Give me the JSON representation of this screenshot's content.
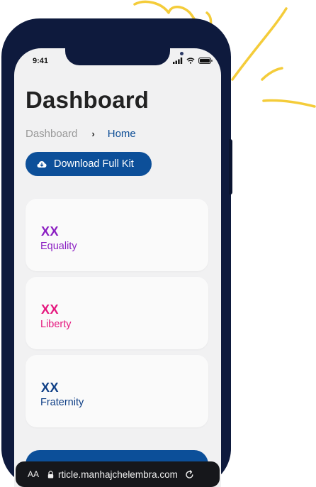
{
  "statusbar": {
    "time": "9:41"
  },
  "page": {
    "title": "Dashboard"
  },
  "breadcrumb": {
    "parent": "Dashboard",
    "separator": "›",
    "current": "Home"
  },
  "download_button": {
    "label": "Download Full Kit",
    "icon": "cloud-download-icon"
  },
  "cards": [
    {
      "code": "XX",
      "label": "Equality",
      "color": "#8b1fc2"
    },
    {
      "code": "XX",
      "label": "Liberty",
      "color": "#e5177e"
    },
    {
      "code": "XX",
      "label": "Fraternity",
      "color": "#0f3f86"
    }
  ],
  "browser": {
    "aa_label": "AA",
    "url": "rticle.manhajchelembra.com"
  },
  "colors": {
    "accent": "#0c4f99",
    "phone_frame": "#0e1a3d",
    "doodle": "#f4cc3a",
    "screen_bg": "#f1f1f2"
  }
}
